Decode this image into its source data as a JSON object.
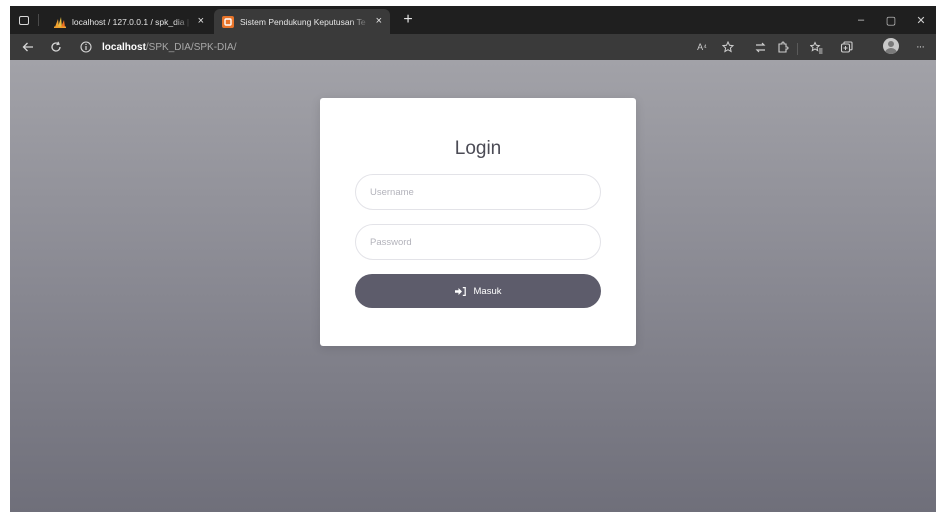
{
  "browser": {
    "tabs": [
      {
        "title": "localhost / 127.0.0.1 / spk_dia | p",
        "close": "×"
      },
      {
        "title": "Sistem Pendukung Keputusan Te",
        "close": "×"
      }
    ],
    "new_tab": "+",
    "window_controls": {
      "minimize": "–",
      "restore": "▢",
      "close": "✕"
    },
    "address": {
      "host": "localhost",
      "path": "/SPK_DIA/SPK-DIA/"
    },
    "read_aloud": "A⁴",
    "more": "···"
  },
  "login": {
    "title": "Login",
    "username_placeholder": "Username",
    "password_placeholder": "Password",
    "submit_label": "Masuk"
  },
  "icons": {
    "tab1_favicon": "phpmyadmin-icon",
    "tab2_favicon": "site-favicon-icon",
    "submit": "sign-in-icon"
  },
  "colors": {
    "background_top": "#a2a2a8",
    "background_bottom": "#6f6f7a",
    "button": "#5d5c6b",
    "tab2_favicon": "#e8742a"
  }
}
